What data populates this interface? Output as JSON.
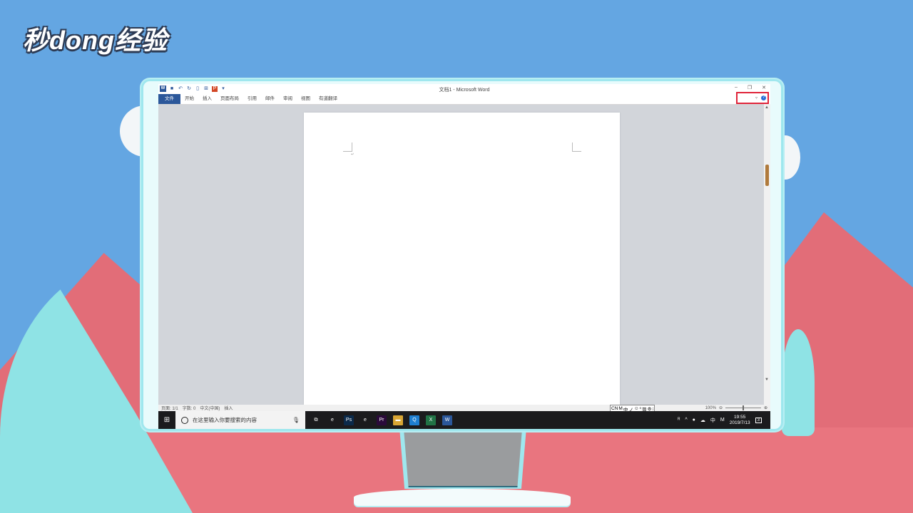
{
  "brand": {
    "text": "秒dong经验"
  },
  "word": {
    "title": "文档1 - Microsoft Word",
    "qat_icons": [
      "word-icon",
      "save-icon",
      "undo-icon",
      "redo-icon",
      "new-doc-icon",
      "format-painter-icon",
      "pdf-icon",
      "customize-icon"
    ],
    "window_controls": [
      "–",
      "❐",
      "✕"
    ],
    "tabs": [
      "文件",
      "开始",
      "插入",
      "页面布局",
      "引用",
      "邮件",
      "审阅",
      "视图",
      "有道翻译"
    ],
    "status": {
      "page": "页面: 1/1",
      "words": "字数: 0",
      "language": "中文(中国)",
      "mode": "插入"
    },
    "ime": [
      "CN",
      "M",
      "中",
      "ノ",
      "☺",
      "⁰",
      "简",
      "⚙",
      "⁝"
    ],
    "zoom": "100%"
  },
  "taskbar": {
    "search_placeholder": "在这里输入你要搜索的内容",
    "apps": [
      {
        "name": "task-view-icon",
        "glyph": "⧉",
        "color": "#1b1b1d"
      },
      {
        "name": "edge-icon",
        "glyph": "e",
        "color": "#1b1b1d"
      },
      {
        "name": "photoshop-icon",
        "glyph": "Ps",
        "color": "#0b2a4a"
      },
      {
        "name": "ie-icon",
        "glyph": "e",
        "color": "#1b1b1d"
      },
      {
        "name": "premiere-icon",
        "glyph": "Pr",
        "color": "#2a0a3a"
      },
      {
        "name": "explorer-icon",
        "glyph": "▬",
        "color": "#d9a634"
      },
      {
        "name": "app-q-icon",
        "glyph": "Q",
        "color": "#1e7fd1"
      },
      {
        "name": "excel-icon",
        "glyph": "X",
        "color": "#217346"
      },
      {
        "name": "word-taskbar-icon",
        "glyph": "W",
        "color": "#2b579a"
      }
    ],
    "time": "19:55",
    "date": "2019/7/13",
    "ime_lang": "中",
    "notif_count": "3"
  }
}
